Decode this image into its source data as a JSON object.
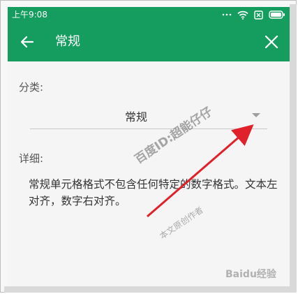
{
  "status_bar": {
    "time": "上午9:08"
  },
  "app_bar": {
    "title": "常规"
  },
  "form": {
    "category_label": "分类:",
    "category_value": "常规",
    "detail_label": "详细:",
    "description": "常规单元格格式不包含任何特定的数字格式。文本左对齐，数字右对齐。"
  },
  "watermark": {
    "line1": "百度ID:超能仔仔",
    "line2": "本文原创作者"
  },
  "brand_watermark": "Baidu经验",
  "colors": {
    "accent": "#159d60",
    "annotation_arrow": "#e0202a"
  }
}
